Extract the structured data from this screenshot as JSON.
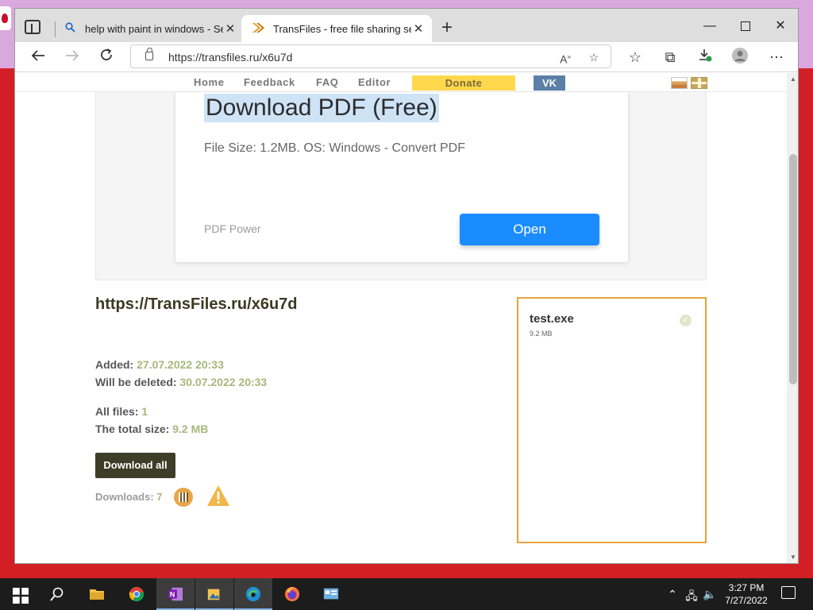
{
  "browser": {
    "tabs": [
      {
        "title": "help with paint in windows - Sea",
        "icon": "search-icon"
      },
      {
        "title": "TransFiles - free file sharing serv",
        "icon": "transfiles-chevron-icon"
      }
    ],
    "url": "https://transfiles.ru/x6u7d"
  },
  "site_nav": {
    "links": [
      "Home",
      "Feedback",
      "FAQ",
      "Editor"
    ],
    "donate": "Donate",
    "vk": "VK"
  },
  "ad": {
    "title": "Download PDF (Free)",
    "subtitle": "File Size: 1.2MB. OS: Windows - Convert PDF",
    "brand": "PDF Power",
    "button": "Open"
  },
  "share": {
    "link": "https://TransFiles.ru/x6u7d",
    "added_label": "Added:",
    "added_value": "27.07.2022 20:33",
    "deleted_label": "Will be deleted:",
    "deleted_value": "30.07.2022 20:33",
    "files_label": "All files:",
    "files_value": "1",
    "size_label": "The total size:",
    "size_value": "9.2 MB",
    "download_all": "Download all",
    "downloads_label": "Downloads:",
    "downloads_value": "7"
  },
  "file": {
    "name": "test.exe",
    "size": "9.2 MB"
  },
  "taskbar": {
    "time": "3:27 PM",
    "date": "7/27/2022"
  },
  "colors": {
    "accent_open": "#1a8cff",
    "donate": "#ffd84d",
    "vk": "#5b7fa6",
    "file_border": "#e7a33b",
    "value_green": "#a7b87a"
  }
}
